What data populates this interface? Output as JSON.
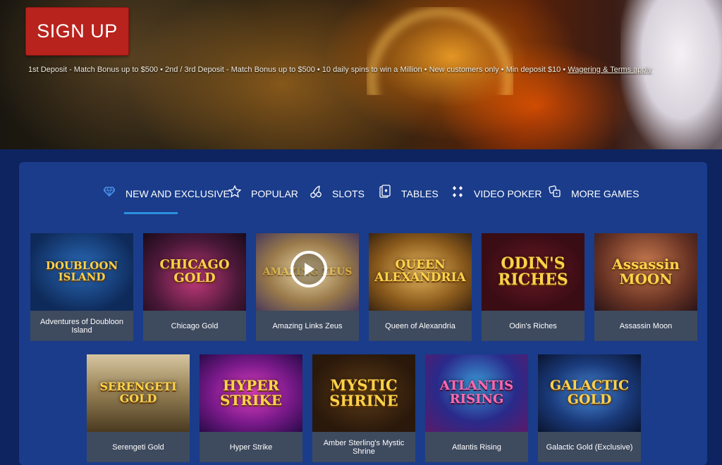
{
  "hero": {
    "signup_label": "SIGN UP",
    "terms_text": "1st Deposit - Match Bonus up to $500 • 2nd / 3rd Deposit - Match Bonus up to $500 • 10 daily spins to win a Million • New customers only • Min deposit $10 •",
    "terms_link": "Wagering & Terms apply"
  },
  "tabs": [
    {
      "label": "NEW AND EXCLUSIVE",
      "icon": "diamond-icon",
      "active": true
    },
    {
      "label": "POPULAR",
      "icon": "star-icon"
    },
    {
      "label": "SLOTS",
      "icon": "cherry-icon"
    },
    {
      "label": "TABLES",
      "icon": "cards-icon"
    },
    {
      "label": "VIDEO POKER",
      "icon": "poker-chips-icon"
    },
    {
      "label": "MORE GAMES",
      "icon": "dice-icon"
    }
  ],
  "games_row1": [
    {
      "name": "Adventures of Doubloon Island",
      "art_text": "DOUBLOON ISLAND"
    },
    {
      "name": "Chicago Gold",
      "art_text": "CHICAGO GOLD"
    },
    {
      "name": "Amazing Links Zeus",
      "art_text": "AMAZING ZEUS"
    },
    {
      "name": "Queen of Alexandria",
      "art_text": "QUEEN ALEXANDRIA"
    },
    {
      "name": "Odin's Riches",
      "art_text": "ODIN'S RICHES"
    },
    {
      "name": "Assassin Moon",
      "art_text": "Assassin MOON"
    }
  ],
  "games_row2": [
    {
      "name": "Serengeti Gold",
      "art_text": "SERENGETI GOLD"
    },
    {
      "name": "Hyper Strike",
      "art_text": "HYPER STRIKE"
    },
    {
      "name": "Amber Sterling's Mystic Shrine",
      "art_text": "MYSTIC SHRINE"
    },
    {
      "name": "Atlantis Rising",
      "art_text": "ATLANTIS RISING"
    },
    {
      "name": "Galactic Gold (Exclusive)",
      "art_text": "GALACTIC GOLD"
    }
  ],
  "colors": {
    "signup_bg": "#b8231d",
    "panel_bg": "#1a3c8a",
    "page_bg": "#0d2460",
    "tab_underline": "#2c8fe0",
    "card_label_bg": "#3e4a5e"
  }
}
